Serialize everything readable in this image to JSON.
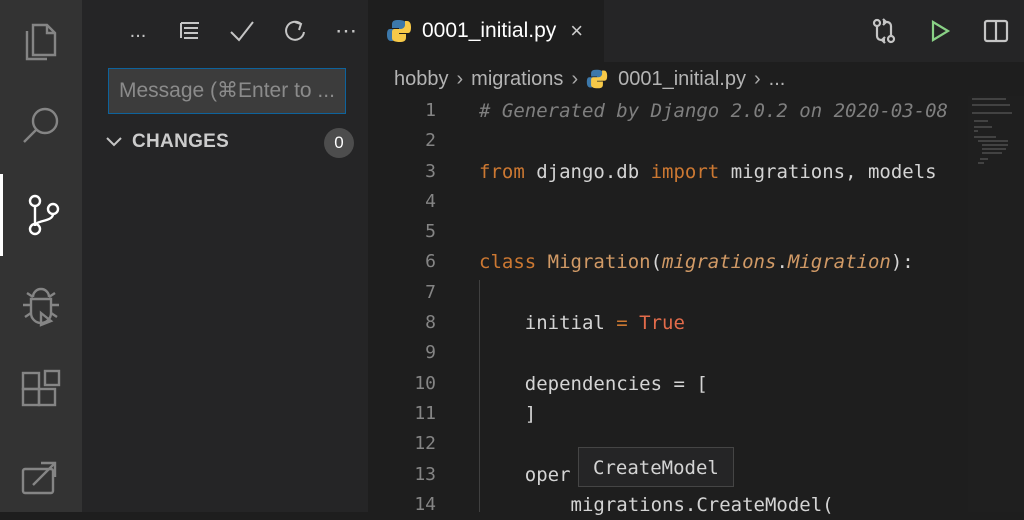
{
  "activity_bar": {
    "items": [
      {
        "icon": "files-icon"
      },
      {
        "icon": "search-icon"
      },
      {
        "icon": "source-control-icon",
        "active": true
      },
      {
        "icon": "debug-icon"
      },
      {
        "icon": "extensions-icon"
      },
      {
        "icon": "remote-explorer-icon"
      }
    ]
  },
  "sidebar": {
    "toolbar": {
      "more_label": "...",
      "overflow_label": "⋯"
    },
    "message_placeholder": "Message (⌘Enter to ...",
    "changes": {
      "label": "CHANGES",
      "count": "0"
    }
  },
  "editor": {
    "tab": {
      "title": "0001_initial.py",
      "close": "×"
    },
    "breadcrumb": {
      "items": [
        "hobby",
        "migrations",
        "0001_initial.py",
        "..."
      ],
      "separator": "›"
    },
    "line_numbers": [
      "1",
      "2",
      "3",
      "4",
      "5",
      "6",
      "7",
      "8",
      "9",
      "10",
      "11",
      "12",
      "13",
      "14"
    ],
    "code": {
      "l1": "# Generated by Django 2.0.2 on 2020-03-08",
      "l3_from": "from",
      "l3_mod": " django.db ",
      "l3_import": "import",
      "l3_rest": " migrations, models",
      "l6_class": "class",
      "l6_name": " Migration",
      "l6_open": "(",
      "l6_base1": "migrations",
      "l6_dot": ".",
      "l6_base2": "Migration",
      "l6_close": "):",
      "l8_name": "    initial ",
      "l8_eq": "=",
      "l8_val": " True",
      "l10": "    dependencies = [",
      "l11": "    ]",
      "l13": "    oper",
      "l14": "        migrations.CreateModel("
    },
    "tooltip": "CreateModel"
  },
  "colors": {
    "accent": "#0e639c",
    "run_green": "#89d185"
  }
}
